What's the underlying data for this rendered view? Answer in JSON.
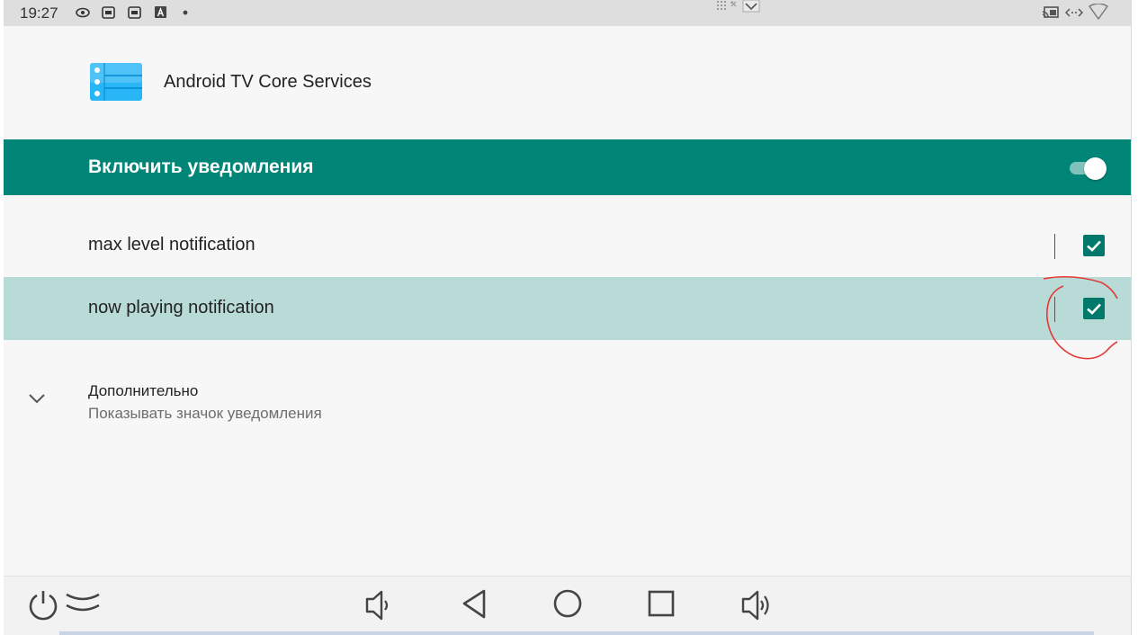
{
  "status_bar": {
    "time": "19:27",
    "left_icons": [
      "eye-icon",
      "cast-box-icon",
      "cast-box-icon",
      "a-letter-icon",
      "dot-icon"
    ],
    "right_icons": [
      "screen-cast-icon",
      "data-arrows-icon",
      "wifi-icon"
    ]
  },
  "app": {
    "name": "Android TV Core Services",
    "icon": "app-list-icon",
    "icon_color": "#29b6f6"
  },
  "enable": {
    "label": "Включить уведомления",
    "checked": true,
    "color": "#008577"
  },
  "channels": [
    {
      "label": "max level notification",
      "checked": true,
      "highlighted": false
    },
    {
      "label": "now playing notification",
      "checked": true,
      "highlighted": true
    }
  ],
  "advanced": {
    "title": "Дополнительно",
    "summary": "Показывать значок уведомления",
    "icon": "chevron-down-icon"
  },
  "nav_bar": {
    "icons": [
      "power-icon",
      "collapse-icon",
      "volume-down-icon",
      "back-icon",
      "home-icon",
      "recents-icon",
      "volume-up-icon"
    ]
  },
  "colors": {
    "accent": "#008577",
    "checkbox": "#00796b",
    "highlight_row": "#b9dbd8",
    "annotation": "#e53935"
  }
}
